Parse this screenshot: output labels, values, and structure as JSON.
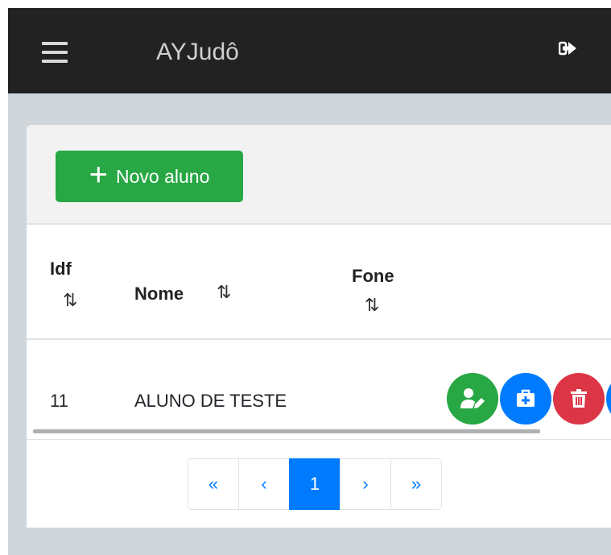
{
  "navbar": {
    "brand": "AYJudô",
    "menu_icon": "hamburger-menu-icon",
    "logout_icon": "sign-out-icon"
  },
  "toolbar": {
    "new_button_icon": "+",
    "new_button_label": "Novo aluno"
  },
  "table": {
    "columns": [
      {
        "label": "Idf",
        "sort_icon": "⇅"
      },
      {
        "label": "Nome",
        "sort_icon": "⇅"
      },
      {
        "label": "Fone",
        "sort_icon": "⇅"
      }
    ],
    "rows": [
      {
        "id": "11",
        "name": "ALUNO DE TESTE",
        "phone": ""
      }
    ],
    "row_actions": [
      {
        "icon": "user-edit-icon",
        "color": "#28a745"
      },
      {
        "icon": "medkit-icon",
        "color": "#007bff"
      },
      {
        "icon": "trash-icon",
        "color": "#dc3545"
      },
      {
        "icon": "more-icon",
        "color": "#007bff"
      }
    ]
  },
  "pagination": {
    "first": "«",
    "prev": "‹",
    "current": "1",
    "next": "›",
    "last": "»"
  },
  "colors": {
    "navbar": "#222222",
    "background": "#d0d6da",
    "primary": "#007bff",
    "success": "#28a745",
    "danger": "#dc3545"
  }
}
